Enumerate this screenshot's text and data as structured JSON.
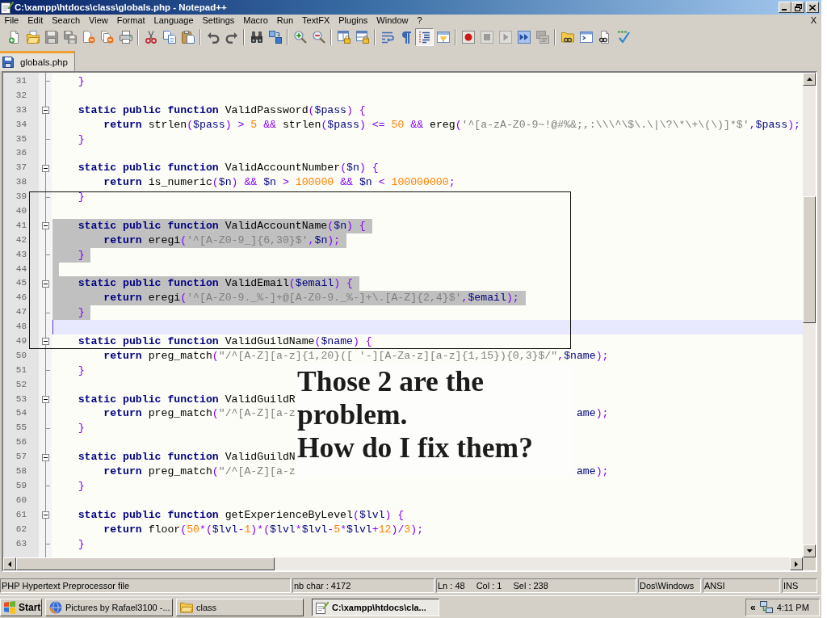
{
  "window": {
    "title": "C:\\xampp\\htdocs\\class\\globals.php - Notepad++"
  },
  "menu": {
    "items": [
      "File",
      "Edit",
      "Search",
      "View",
      "Format",
      "Language",
      "Settings",
      "Macro",
      "Run",
      "TextFX",
      "Plugins",
      "Window",
      "?"
    ],
    "close_document": "X"
  },
  "toolbar": [
    [
      {
        "kind": "new",
        "pressed": false,
        "disabled": false
      },
      {
        "kind": "open",
        "pressed": false,
        "disabled": false
      },
      {
        "kind": "save",
        "pressed": false,
        "disabled": true
      },
      {
        "kind": "saveall",
        "pressed": false,
        "disabled": true
      },
      {
        "kind": "close",
        "pressed": false,
        "disabled": false
      },
      {
        "kind": "closeall",
        "pressed": false,
        "disabled": false
      },
      {
        "kind": "print",
        "pressed": false,
        "disabled": false
      }
    ],
    [
      {
        "kind": "cut",
        "pressed": false,
        "disabled": false
      },
      {
        "kind": "copy",
        "pressed": false,
        "disabled": false
      },
      {
        "kind": "paste",
        "pressed": false,
        "disabled": false
      }
    ],
    [
      {
        "kind": "undo",
        "pressed": false,
        "disabled": false
      },
      {
        "kind": "redo",
        "pressed": false,
        "disabled": false
      }
    ],
    [
      {
        "kind": "find",
        "pressed": false,
        "disabled": false
      },
      {
        "kind": "replace",
        "pressed": false,
        "disabled": false
      }
    ],
    [
      {
        "kind": "zoomin",
        "pressed": false,
        "disabled": false
      },
      {
        "kind": "zoomout",
        "pressed": false,
        "disabled": false
      }
    ],
    [
      {
        "kind": "syncv",
        "pressed": false,
        "disabled": false
      },
      {
        "kind": "synch",
        "pressed": false,
        "disabled": false
      }
    ],
    [
      {
        "kind": "wrap",
        "pressed": false,
        "disabled": false
      },
      {
        "kind": "allchars",
        "pressed": false,
        "disabled": false
      },
      {
        "kind": "indentguide",
        "pressed": true,
        "disabled": false
      },
      {
        "kind": "udl",
        "pressed": false,
        "disabled": false
      }
    ],
    [
      {
        "kind": "record",
        "pressed": false,
        "disabled": false
      },
      {
        "kind": "stop",
        "pressed": false,
        "disabled": true
      },
      {
        "kind": "play",
        "pressed": false,
        "disabled": true
      },
      {
        "kind": "playmulti",
        "pressed": false,
        "disabled": false
      },
      {
        "kind": "savemacro",
        "pressed": false,
        "disabled": true
      }
    ],
    [
      {
        "kind": "folderlink",
        "pressed": false,
        "disabled": false
      },
      {
        "kind": "console",
        "pressed": false,
        "disabled": false
      },
      {
        "kind": "doclink",
        "pressed": false,
        "disabled": false
      },
      {
        "kind": "spellcheck",
        "pressed": false,
        "disabled": false
      }
    ]
  ],
  "tabs": [
    {
      "label": "globals.php",
      "selected": true
    }
  ],
  "editor": {
    "lines": [
      {
        "number": "31",
        "kind": "foldend",
        "selected": false,
        "current": false,
        "tokens": [
          {
            "kind": "operator",
            "text": "}"
          }
        ]
      },
      {
        "number": "32",
        "kind": "line",
        "selected": false,
        "current": false
      },
      {
        "number": "33",
        "kind": "foldstart",
        "expanded": true,
        "selected": false,
        "current": false,
        "tokens": [
          {
            "kind": "keyword",
            "text": "static public function"
          },
          {
            "kind": "plain",
            "text": " ValidPassword"
          },
          {
            "kind": "operator",
            "text": "("
          },
          {
            "kind": "variable",
            "text": "$pass"
          },
          {
            "kind": "operator",
            "text": ") {"
          }
        ],
        "children": [
          {
            "number": "34",
            "selected": false,
            "current": false,
            "tokens": [
              {
                "kind": "keyword",
                "text": "return"
              },
              {
                "kind": "plain",
                "text": " strlen"
              },
              {
                "kind": "operator",
                "text": "("
              },
              {
                "kind": "variable",
                "text": "$pass"
              },
              {
                "kind": "operator",
                "text": ") > "
              },
              {
                "kind": "number",
                "text": "5"
              },
              {
                "kind": "operator",
                "text": " && "
              },
              {
                "kind": "plain",
                "text": "strlen"
              },
              {
                "kind": "operator",
                "text": "("
              },
              {
                "kind": "variable",
                "text": "$pass"
              },
              {
                "kind": "operator",
                "text": ") <= "
              },
              {
                "kind": "number",
                "text": "50"
              },
              {
                "kind": "operator",
                "text": " && "
              },
              {
                "kind": "plain",
                "text": "ereg"
              },
              {
                "kind": "operator",
                "text": "("
              },
              {
                "kind": "string",
                "text": "'^[a-zA-Z0-9~!@#%&;,:\\\\\\^\\$\\.\\|\\?\\*\\+\\(\\)]*$'"
              },
              {
                "kind": "operator",
                "text": ","
              },
              {
                "kind": "variable",
                "text": "$pass"
              },
              {
                "kind": "operator",
                "text": ");"
              }
            ]
          }
        ]
      },
      {
        "number": "35",
        "kind": "foldend",
        "selected": false,
        "current": false,
        "tokens": [
          {
            "kind": "operator",
            "text": "}"
          }
        ]
      },
      {
        "number": "36",
        "kind": "line",
        "selected": false,
        "current": false
      },
      {
        "number": "37",
        "kind": "foldstart",
        "expanded": true,
        "selected": false,
        "current": false,
        "tokens": [
          {
            "kind": "keyword",
            "text": "static public function"
          },
          {
            "kind": "plain",
            "text": " ValidAccountNumber"
          },
          {
            "kind": "operator",
            "text": "("
          },
          {
            "kind": "variable",
            "text": "$n"
          },
          {
            "kind": "operator",
            "text": ") {"
          }
        ],
        "children": [
          {
            "number": "38",
            "selected": false,
            "current": false,
            "tokens": [
              {
                "kind": "keyword",
                "text": "return"
              },
              {
                "kind": "plain",
                "text": " is_numeric"
              },
              {
                "kind": "operator",
                "text": "("
              },
              {
                "kind": "variable",
                "text": "$n"
              },
              {
                "kind": "operator",
                "text": ") && "
              },
              {
                "kind": "variable",
                "text": "$n"
              },
              {
                "kind": "operator",
                "text": " > "
              },
              {
                "kind": "number",
                "text": "100000"
              },
              {
                "kind": "operator",
                "text": " && "
              },
              {
                "kind": "variable",
                "text": "$n"
              },
              {
                "kind": "operator",
                "text": " < "
              },
              {
                "kind": "number",
                "text": "100000000"
              },
              {
                "kind": "operator",
                "text": ";"
              }
            ]
          }
        ]
      },
      {
        "number": "39",
        "kind": "foldend",
        "selected": false,
        "current": false,
        "tokens": [
          {
            "kind": "operator",
            "text": "}"
          }
        ]
      },
      {
        "number": "40",
        "kind": "line",
        "selected": false,
        "current": false
      },
      {
        "number": "41",
        "kind": "foldstart",
        "expanded": true,
        "selected": true,
        "current": false,
        "tokens": [
          {
            "kind": "keyword",
            "text": "static public function"
          },
          {
            "kind": "plain",
            "text": " ValidAccountName"
          },
          {
            "kind": "operator",
            "text": "("
          },
          {
            "kind": "variable",
            "text": "$n"
          },
          {
            "kind": "operator",
            "text": ") {"
          }
        ],
        "children": [
          {
            "number": "42",
            "selected": true,
            "current": false,
            "tokens": [
              {
                "kind": "keyword",
                "text": "return"
              },
              {
                "kind": "plain",
                "text": " eregi"
              },
              {
                "kind": "operator",
                "text": "("
              },
              {
                "kind": "string",
                "text": "'^[A-Z0-9_]{6,30}$'"
              },
              {
                "kind": "operator",
                "text": ","
              },
              {
                "kind": "variable",
                "text": "$n"
              },
              {
                "kind": "operator",
                "text": ");"
              }
            ]
          }
        ]
      },
      {
        "number": "43",
        "kind": "foldend",
        "selected": true,
        "current": false,
        "tokens": [
          {
            "kind": "operator",
            "text": "}"
          }
        ]
      },
      {
        "number": "44",
        "kind": "line",
        "selected": true,
        "current": false
      },
      {
        "number": "45",
        "kind": "foldstart",
        "expanded": true,
        "selected": true,
        "current": false,
        "tokens": [
          {
            "kind": "keyword",
            "text": "static public function"
          },
          {
            "kind": "plain",
            "text": " ValidEmail"
          },
          {
            "kind": "operator",
            "text": "("
          },
          {
            "kind": "variable",
            "text": "$email"
          },
          {
            "kind": "operator",
            "text": ") {"
          }
        ],
        "children": [
          {
            "number": "46",
            "selected": true,
            "current": false,
            "tokens": [
              {
                "kind": "keyword",
                "text": "return"
              },
              {
                "kind": "plain",
                "text": " eregi"
              },
              {
                "kind": "operator",
                "text": "("
              },
              {
                "kind": "string",
                "text": "'^[A-Z0-9._%-]+@[A-Z0-9._%-]+\\.[A-Z]{2,4}$'"
              },
              {
                "kind": "operator",
                "text": ","
              },
              {
                "kind": "variable",
                "text": "$email"
              },
              {
                "kind": "operator",
                "text": ");"
              }
            ]
          }
        ]
      },
      {
        "number": "47",
        "kind": "foldend",
        "selected": true,
        "current": false,
        "tokens": [
          {
            "kind": "operator",
            "text": "}"
          }
        ]
      },
      {
        "number": "48",
        "kind": "line",
        "selected": false,
        "current": true
      },
      {
        "number": "49",
        "kind": "foldstart",
        "expanded": true,
        "selected": false,
        "current": false,
        "tokens": [
          {
            "kind": "keyword",
            "text": "static public function"
          },
          {
            "kind": "plain",
            "text": " ValidGuildName"
          },
          {
            "kind": "operator",
            "text": "("
          },
          {
            "kind": "variable",
            "text": "$name"
          },
          {
            "kind": "operator",
            "text": ") {"
          }
        ],
        "children": [
          {
            "number": "50",
            "selected": false,
            "current": false,
            "tokens": [
              {
                "kind": "keyword",
                "text": "return"
              },
              {
                "kind": "plain",
                "text": " preg_match"
              },
              {
                "kind": "operator",
                "text": "("
              },
              {
                "kind": "string",
                "text": "\"/^[A-Z][a-z]{1,20}([ '-][A-Za-z][a-z]{1,15}){0,3}$/\""
              },
              {
                "kind": "operator",
                "text": ","
              },
              {
                "kind": "variable",
                "text": "$name"
              },
              {
                "kind": "operator",
                "text": ");"
              }
            ]
          }
        ]
      },
      {
        "number": "51",
        "kind": "foldend",
        "selected": false,
        "current": false,
        "tokens": [
          {
            "kind": "operator",
            "text": "}"
          }
        ]
      },
      {
        "number": "52",
        "kind": "line",
        "selected": false,
        "current": false
      },
      {
        "number": "53",
        "kind": "foldstart",
        "expanded": true,
        "selected": false,
        "current": false,
        "tokens": [
          {
            "kind": "keyword",
            "text": "static public function"
          },
          {
            "kind": "plain",
            "text": " ValidGuildR"
          }
        ],
        "children": [
          {
            "number": "54",
            "selected": false,
            "current": false,
            "tokens": [
              {
                "kind": "keyword",
                "text": "return"
              },
              {
                "kind": "plain",
                "text": " preg_match"
              },
              {
                "kind": "operator",
                "text": "("
              },
              {
                "kind": "string",
                "text": "\"/^[A-Z][a-z"
              }
            ],
            "end_tokens": [
              {
                "kind": "variable",
                "text": "ame"
              },
              {
                "kind": "operator",
                "text": ");"
              }
            ]
          }
        ]
      },
      {
        "number": "55",
        "kind": "foldend",
        "selected": false,
        "current": false,
        "tokens": [
          {
            "kind": "operator",
            "text": "}"
          }
        ]
      },
      {
        "number": "56",
        "kind": "line",
        "selected": false,
        "current": false
      },
      {
        "number": "57",
        "kind": "foldstart",
        "expanded": true,
        "selected": false,
        "current": false,
        "tokens": [
          {
            "kind": "keyword",
            "text": "static public function"
          },
          {
            "kind": "plain",
            "text": " ValidGuildN"
          }
        ],
        "children": [
          {
            "number": "58",
            "selected": false,
            "current": false,
            "tokens": [
              {
                "kind": "keyword",
                "text": "return"
              },
              {
                "kind": "plain",
                "text": " preg_match"
              },
              {
                "kind": "operator",
                "text": "("
              },
              {
                "kind": "string",
                "text": "\"/^[A-Z][a-z"
              }
            ],
            "end_tokens": [
              {
                "kind": "variable",
                "text": "ame"
              },
              {
                "kind": "operator",
                "text": ");"
              }
            ]
          }
        ]
      },
      {
        "number": "59",
        "kind": "foldend",
        "selected": false,
        "current": false,
        "tokens": [
          {
            "kind": "operator",
            "text": "}"
          }
        ]
      },
      {
        "number": "60",
        "kind": "line",
        "selected": false,
        "current": false
      },
      {
        "number": "61",
        "kind": "foldstart",
        "expanded": true,
        "selected": false,
        "current": false,
        "tokens": [
          {
            "kind": "keyword",
            "text": "static public function"
          },
          {
            "kind": "plain",
            "text": " getExperienceByLevel"
          },
          {
            "kind": "operator",
            "text": "("
          },
          {
            "kind": "variable",
            "text": "$lvl"
          },
          {
            "kind": "operator",
            "text": ") {"
          }
        ],
        "children": [
          {
            "number": "62",
            "selected": false,
            "current": false,
            "tokens": [
              {
                "kind": "keyword",
                "text": "return"
              },
              {
                "kind": "plain",
                "text": " floor"
              },
              {
                "kind": "operator",
                "text": "("
              },
              {
                "kind": "number",
                "text": "50"
              },
              {
                "kind": "operator",
                "text": "*("
              },
              {
                "kind": "variable",
                "text": "$lvl"
              },
              {
                "kind": "operator",
                "text": "-"
              },
              {
                "kind": "number",
                "text": "1"
              },
              {
                "kind": "operator",
                "text": ")*("
              },
              {
                "kind": "variable",
                "text": "$lvl"
              },
              {
                "kind": "operator",
                "text": "*"
              },
              {
                "kind": "variable",
                "text": "$lvl"
              },
              {
                "kind": "operator",
                "text": "-"
              },
              {
                "kind": "number",
                "text": "5"
              },
              {
                "kind": "operator",
                "text": "*"
              },
              {
                "kind": "variable",
                "text": "$lvl"
              },
              {
                "kind": "operator",
                "text": "+"
              },
              {
                "kind": "number",
                "text": "12"
              },
              {
                "kind": "operator",
                "text": ")/"
              },
              {
                "kind": "number",
                "text": "3"
              },
              {
                "kind": "operator",
                "text": ");"
              }
            ]
          }
        ]
      },
      {
        "number": "63",
        "kind": "foldend",
        "selected": false,
        "current": false,
        "tokens": [
          {
            "kind": "operator",
            "text": "}"
          }
        ]
      }
    ]
  },
  "annotation": {
    "note": [
      "Those 2 are the problem.",
      "How do I fix them?"
    ]
  },
  "status_bar": [
    [
      "PHP Hypertext Preprocessor file"
    ],
    [
      "nb char : 4172"
    ],
    [
      "Ln : 48",
      "Col : 1",
      "Sel : 238"
    ],
    [
      "Dos\\Windows"
    ],
    [
      "ANSI"
    ],
    [
      "INS"
    ]
  ],
  "taskbar": {
    "start": "Start",
    "tasks": [
      {
        "kind": "browser",
        "label": "Pictures by Rafael3100 -...",
        "selected": false
      },
      {
        "kind": "folder",
        "label": "class",
        "selected": false
      },
      {
        "kind": "editor",
        "label": "C:\\xampp\\htdocs\\cla...",
        "selected": true
      }
    ],
    "tray": {
      "expand": "«",
      "clock": "4:11 PM"
    }
  }
}
